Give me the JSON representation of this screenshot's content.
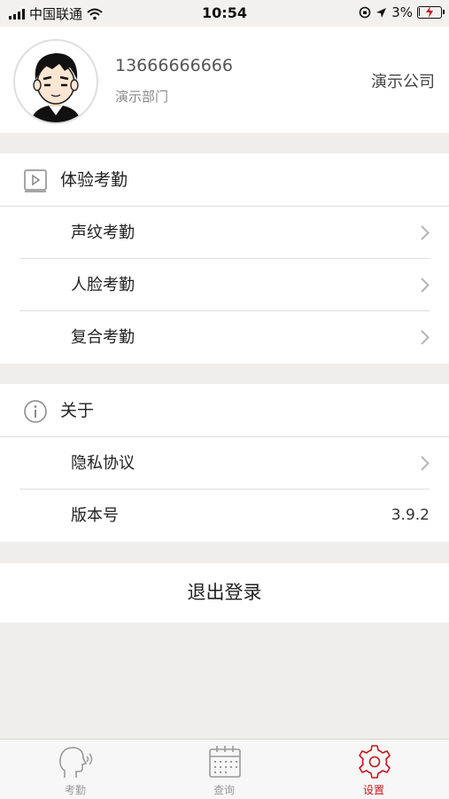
{
  "status_bar": {
    "carrier": "中国联通",
    "time": "10:54",
    "battery": "3%",
    "battery_level": 0.03
  },
  "profile": {
    "phone": "13666666666",
    "department": "演示部门",
    "company": "演示公司"
  },
  "sections": {
    "attendance": {
      "title": "体验考勤",
      "icon": "video-play-icon",
      "items": [
        {
          "label": "声纹考勤"
        },
        {
          "label": "人脸考勤"
        },
        {
          "label": "复合考勤"
        }
      ]
    },
    "about": {
      "title": "关于",
      "icon": "info-icon",
      "items": [
        {
          "label": "隐私协议"
        },
        {
          "label": "版本号",
          "value": "3.9.2"
        }
      ]
    }
  },
  "logout_label": "退出登录",
  "tabbar": {
    "tabs": [
      {
        "label": "考勤",
        "icon": "voice-head-icon",
        "active": false
      },
      {
        "label": "查询",
        "icon": "calendar-icon",
        "active": false
      },
      {
        "label": "设置",
        "icon": "gear-icon",
        "active": true
      }
    ],
    "active_color": "#c8161d",
    "inactive_color": "#999999"
  }
}
